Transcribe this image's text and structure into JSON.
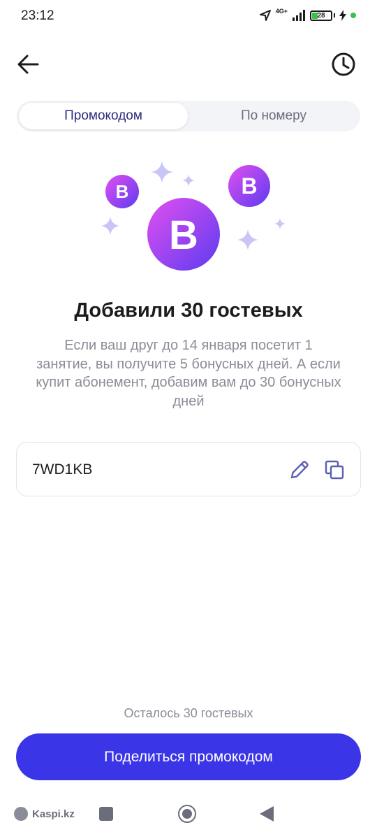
{
  "status_bar": {
    "time": "23:12",
    "network": "4G+",
    "battery_level": "28",
    "battery_fraction": 0.28
  },
  "header": {
    "back_icon": "arrow-left-icon",
    "history_icon": "clock-icon"
  },
  "tabs": [
    {
      "label": "Промокодом",
      "active": true
    },
    {
      "label": "По номеру",
      "active": false
    }
  ],
  "illustration": {
    "badge_letter": "B",
    "badge_gradient": [
      "#e24ff0",
      "#5b3cf0"
    ],
    "sparkle_color": "#c9c6f7"
  },
  "main": {
    "title": "Добавили 30 гостевых",
    "description": "Если ваш друг до 14 января посетит 1 занятие, вы получите 5 бонусных дней. А если купит абонемент, добавим вам до 30 бонусных дней"
  },
  "promo": {
    "code": "7WD1KB",
    "edit_icon": "pencil-icon",
    "copy_icon": "copy-icon"
  },
  "footer": {
    "remaining_text": "Осталось 30 гостевых",
    "share_label": "Поделиться промокодом",
    "accent_color": "#3b35e8"
  },
  "nav": {
    "watermark": "Kaspi.kz"
  }
}
